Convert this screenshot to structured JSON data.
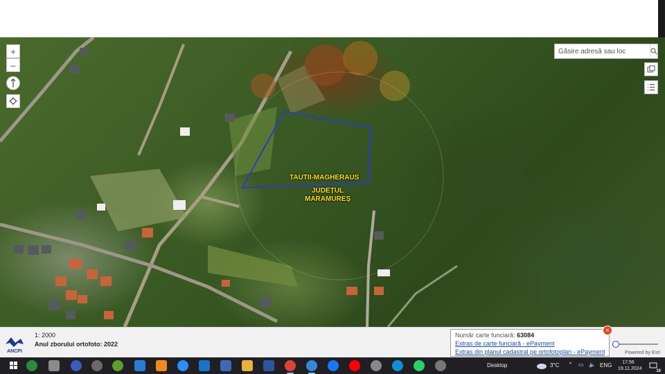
{
  "map": {
    "zoom_in": "+",
    "zoom_out": "–",
    "search_placeholder": "Găsire adresă sau loc",
    "place_label": "TAUTII-MAGHERAUS",
    "county_label_1": "JUDEȚUL",
    "county_label_2": "MARAMUREȘ",
    "parcel_color": "#2a3dbf",
    "label_color": "#ffe600"
  },
  "info": {
    "scale": "1: 2000",
    "year_label": "Anul zborului ortofoto:",
    "year_value": "2022",
    "logo_text": "ANCPI"
  },
  "popup": {
    "title": "Număr carte funciară:",
    "number": "63084",
    "link1": "Extras de carte funciară - ePayment",
    "link2": "Extras din planul cadastral pe ortofotoplan - ePayment",
    "close": "×"
  },
  "powered_by": "Powered by Esri",
  "taskbar": {
    "desktop_label": "Desktop",
    "temperature": "3°C",
    "language": "ENG",
    "time": "17:56",
    "date": "19.11.2024",
    "notification_count": "10"
  }
}
